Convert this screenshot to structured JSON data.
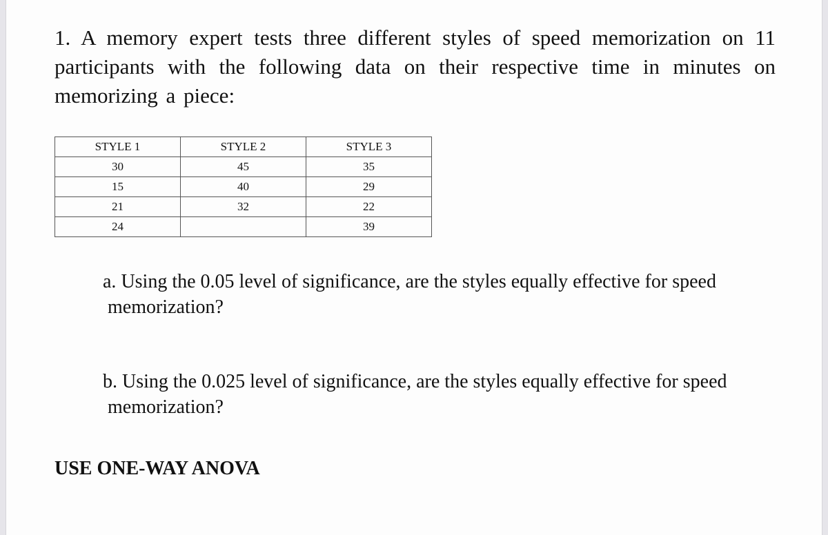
{
  "problem": {
    "number": "1.",
    "intro_text": "A memory expert tests three different styles of speed memorization on 11 participants with the following data on their respective time in minutes on memorizing a piece:"
  },
  "table": {
    "headers": [
      "STYLE 1",
      "STYLE 2",
      "STYLE 3"
    ],
    "rows": [
      [
        "30",
        "45",
        "35"
      ],
      [
        "15",
        "40",
        "29"
      ],
      [
        "21",
        "32",
        "22"
      ],
      [
        "24",
        "",
        "39"
      ]
    ]
  },
  "questions": [
    {
      "label": "a.",
      "line1": "Using the 0.05 level of significance, are the styles equally effective for speed",
      "line2": "memorization?"
    },
    {
      "label": "b.",
      "line1": "Using the 0.025 level of significance, are the styles equally effective for speed",
      "line2": "memorization?"
    }
  ],
  "instruction": "USE ONE-WAY ANOVA"
}
